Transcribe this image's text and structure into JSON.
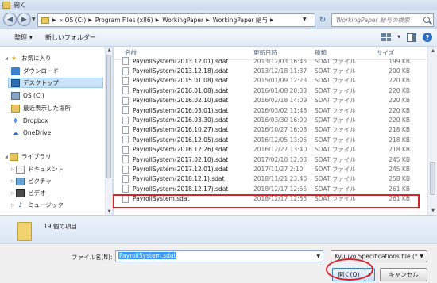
{
  "window": {
    "title": "開く"
  },
  "address": {
    "crumbs": [
      "« OS (C:)",
      "Program Files (x86)",
      "WorkingPaper",
      "WorkingPaper 給与"
    ],
    "search_placeholder": "WorkingPaper 給与の検索"
  },
  "toolbar": {
    "organize": "整理",
    "new_folder": "新しいフォルダー"
  },
  "nav": {
    "favorites": "お気に入り",
    "downloads": "ダウンロード",
    "desktop": "デスクトップ",
    "os_c": "OS (C:)",
    "recent": "最近表示した場所",
    "dropbox": "Dropbox",
    "onedrive": "OneDrive",
    "libraries": "ライブラリ",
    "documents": "ドキュメント",
    "pictures": "ピクチャ",
    "videos": "ビデオ",
    "music": "ミュージック"
  },
  "columns": {
    "name": "名前",
    "date": "更新日時",
    "type": "種類",
    "size": "サイズ"
  },
  "files": [
    {
      "name": "PayrollSystem(2013.12.01).sdat",
      "date": "2013/12/03 16:45",
      "type": "SDAT ファイル",
      "size": "199 KB"
    },
    {
      "name": "PayrollSystem(2013.12.18).sdat",
      "date": "2013/12/18 11:37",
      "type": "SDAT ファイル",
      "size": "200 KB"
    },
    {
      "name": "PayrollSystem(2015.01.08).sdat",
      "date": "2015/01/09 12:23",
      "type": "SDAT ファイル",
      "size": "220 KB"
    },
    {
      "name": "PayrollSystem(2016.01.08).sdat",
      "date": "2016/01/08 20:33",
      "type": "SDAT ファイル",
      "size": "220 KB"
    },
    {
      "name": "PayrollSystem(2016.02.10).sdat",
      "date": "2016/02/18 14:09",
      "type": "SDAT ファイル",
      "size": "220 KB"
    },
    {
      "name": "PayrollSystem(2016.03.01).sdat",
      "date": "2016/03/02 11:48",
      "type": "SDAT ファイル",
      "size": "220 KB"
    },
    {
      "name": "PayrollSystem(2016.03.30).sdat",
      "date": "2016/03/30 16:00",
      "type": "SDAT ファイル",
      "size": "220 KB"
    },
    {
      "name": "PayrollSystem(2016.10.27).sdat",
      "date": "2016/10/27 16:08",
      "type": "SDAT ファイル",
      "size": "218 KB"
    },
    {
      "name": "PayrollSystem(2016.12.05).sdat",
      "date": "2016/12/05 13:05",
      "type": "SDAT ファイル",
      "size": "218 KB"
    },
    {
      "name": "PayrollSystem(2016.12.26).sdat",
      "date": "2016/12/27 13:40",
      "type": "SDAT ファイル",
      "size": "218 KB"
    },
    {
      "name": "PayrollSystem(2017.02.10).sdat",
      "date": "2017/02/10 12:03",
      "type": "SDAT ファイル",
      "size": "245 KB"
    },
    {
      "name": "PayrollSystem(2017.12.01).sdat",
      "date": "2017/11/27 2:10",
      "type": "SDAT ファイル",
      "size": "245 KB"
    },
    {
      "name": "PayrollSystem(2018.12.1).sdat",
      "date": "2018/11/21 23:40",
      "type": "SDAT ファイル",
      "size": "258 KB"
    },
    {
      "name": "PayrollSystem(2018.12.17).sdat",
      "date": "2018/12/17 12:55",
      "type": "SDAT ファイル",
      "size": "261 KB"
    },
    {
      "name": "PayrollSystem.sdat",
      "date": "2018/12/17 12:55",
      "type": "SDAT ファイル",
      "size": "261 KB"
    }
  ],
  "details": {
    "item_count": "19 個の項目"
  },
  "bottom": {
    "filename_label": "ファイル名(N):",
    "filename_value": "PayrollSystem.sdat",
    "filetype": "Kyuuyo Specifications file (*",
    "open_label": "開く(O)",
    "cancel_label": "キャンセル"
  },
  "colors": {
    "highlight": "#d4222c",
    "selection": "#cce4f7"
  }
}
